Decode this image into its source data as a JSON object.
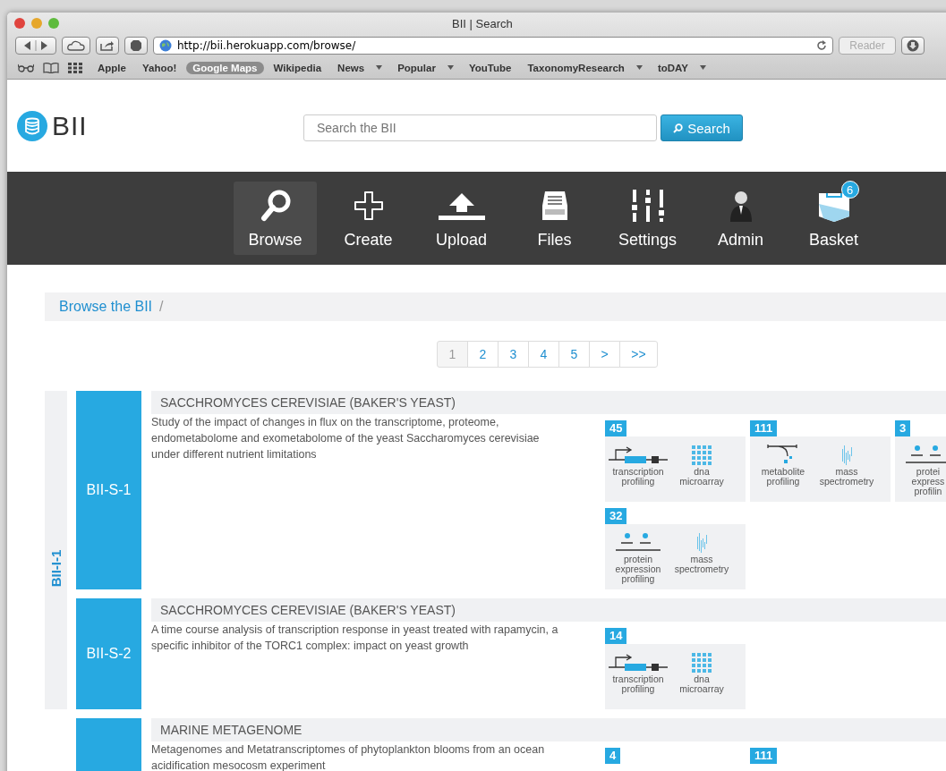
{
  "window": {
    "title": "BII | Search"
  },
  "browser": {
    "url": "http://bii.herokuapp.com/browse/",
    "reader": "Reader",
    "bookmarks": [
      {
        "label": "Apple",
        "menu": false,
        "selected": false
      },
      {
        "label": "Yahoo!",
        "menu": false,
        "selected": false
      },
      {
        "label": "Google Maps",
        "menu": false,
        "selected": true
      },
      {
        "label": "Wikipedia",
        "menu": false,
        "selected": false
      },
      {
        "label": "News",
        "menu": true,
        "selected": false
      },
      {
        "label": "Popular",
        "menu": true,
        "selected": false
      },
      {
        "label": "YouTube",
        "menu": false,
        "selected": false
      },
      {
        "label": "TaxonomyResearch",
        "menu": true,
        "selected": false
      },
      {
        "label": "toDAY",
        "menu": true,
        "selected": false
      }
    ]
  },
  "logo": {
    "text": "BII"
  },
  "search": {
    "placeholder": "Search the BII",
    "button": "Search"
  },
  "nav": [
    {
      "label": "Browse",
      "kind": "search",
      "selected": true
    },
    {
      "label": "Create",
      "kind": "plus",
      "selected": false
    },
    {
      "label": "Upload",
      "kind": "upload",
      "selected": false
    },
    {
      "label": "Files",
      "kind": "files",
      "selected": false
    },
    {
      "label": "Settings",
      "kind": "settings",
      "selected": false
    },
    {
      "label": "Admin",
      "kind": "admin",
      "selected": false
    },
    {
      "label": "Basket",
      "kind": "basket",
      "selected": false,
      "badge": "6"
    }
  ],
  "breadcrumb": [
    {
      "label": "Browse the BII",
      "separator": "/"
    }
  ],
  "pagination": [
    {
      "label": "1",
      "selected": true
    },
    {
      "label": "2",
      "selected": false
    },
    {
      "label": "3",
      "selected": false
    },
    {
      "label": "4",
      "selected": false
    },
    {
      "label": "5",
      "selected": false
    },
    {
      "label": ">",
      "selected": false
    },
    {
      "label": ">>",
      "selected": false
    }
  ],
  "investigations": [
    {
      "id": "BII-I-1",
      "studies": [
        {
          "id": "BII-S-1",
          "title": "SACCHROMYCES CEREVISIAE (BAKER'S YEAST)",
          "description": "Study of the impact of changes in flux on the transcriptome, proteome, endometabolome and exometabolome of the yeast Saccharomyces cerevisiae under different nutrient limitations",
          "assays": [
            {
              "count": "45",
              "items": [
                {
                  "kind": "transcription",
                  "label_lines": [
                    "transcription",
                    "profiling"
                  ]
                },
                {
                  "kind": "microarray",
                  "label_lines": [
                    "dna",
                    "microarray"
                  ]
                }
              ]
            },
            {
              "count": "111",
              "items": [
                {
                  "kind": "metabolite",
                  "label_lines": [
                    "metabolite",
                    "profiling"
                  ]
                },
                {
                  "kind": "mass",
                  "label_lines": [
                    "mass",
                    "spectrometry"
                  ]
                }
              ]
            },
            {
              "count": "3",
              "items": [
                {
                  "kind": "protein",
                  "label_lines": [
                    "protei",
                    "express",
                    "profilin"
                  ]
                }
              ]
            },
            {
              "count": "32",
              "items": [
                {
                  "kind": "protein",
                  "label_lines": [
                    "protein",
                    "expression",
                    "profiling"
                  ]
                },
                {
                  "kind": "mass",
                  "label_lines": [
                    "mass",
                    "spectrometry"
                  ]
                }
              ]
            }
          ]
        },
        {
          "id": "BII-S-2",
          "title": "SACCHROMYCES CEREVISIAE (BAKER'S YEAST)",
          "description": "A time course analysis of transcription response in yeast treated with rapamycin, a specific inhibitor of the TORC1 complex: impact on yeast growth",
          "assays": [
            {
              "count": "14",
              "items": [
                {
                  "kind": "transcription",
                  "label_lines": [
                    "transcription",
                    "profiling"
                  ]
                },
                {
                  "kind": "microarray",
                  "label_lines": [
                    "dna",
                    "microarray"
                  ]
                }
              ]
            }
          ]
        }
      ]
    },
    {
      "studies": [
        {
          "title": "MARINE METAGENOME",
          "description": "Metagenomes and Metatranscriptomes of phytoplankton blooms from an ocean acidification mesocosm experiment",
          "assays": [
            {
              "count": "4"
            },
            {
              "count": "111"
            }
          ]
        }
      ]
    }
  ]
}
